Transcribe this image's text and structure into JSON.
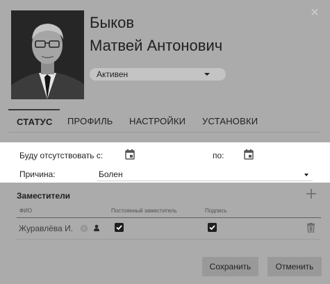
{
  "dialog": {
    "person": {
      "last_name": "Быков",
      "first_name": "Матвей Антонович"
    },
    "status_select": {
      "value": "Активен"
    },
    "tabs": [
      {
        "label": "СТАТУС",
        "active": true
      },
      {
        "label": "ПРОФИЛЬ",
        "active": false
      },
      {
        "label": "НАСТРОЙКИ",
        "active": false
      },
      {
        "label": "УСТАНОВКИ",
        "active": false
      }
    ],
    "absence": {
      "from_label": "Буду отсутствовать с:",
      "to_label": "по:",
      "reason_label": "Причина:",
      "reason_value": "Болен"
    },
    "deputies": {
      "title": "Заместители",
      "columns": [
        "ФИО",
        "Постоянный заместитель",
        "Подпись"
      ],
      "rows": [
        {
          "name": "Журавлёва И.",
          "permanent": true,
          "signature": true
        }
      ]
    },
    "buttons": {
      "save": "Сохранить",
      "cancel": "Отменить"
    }
  }
}
